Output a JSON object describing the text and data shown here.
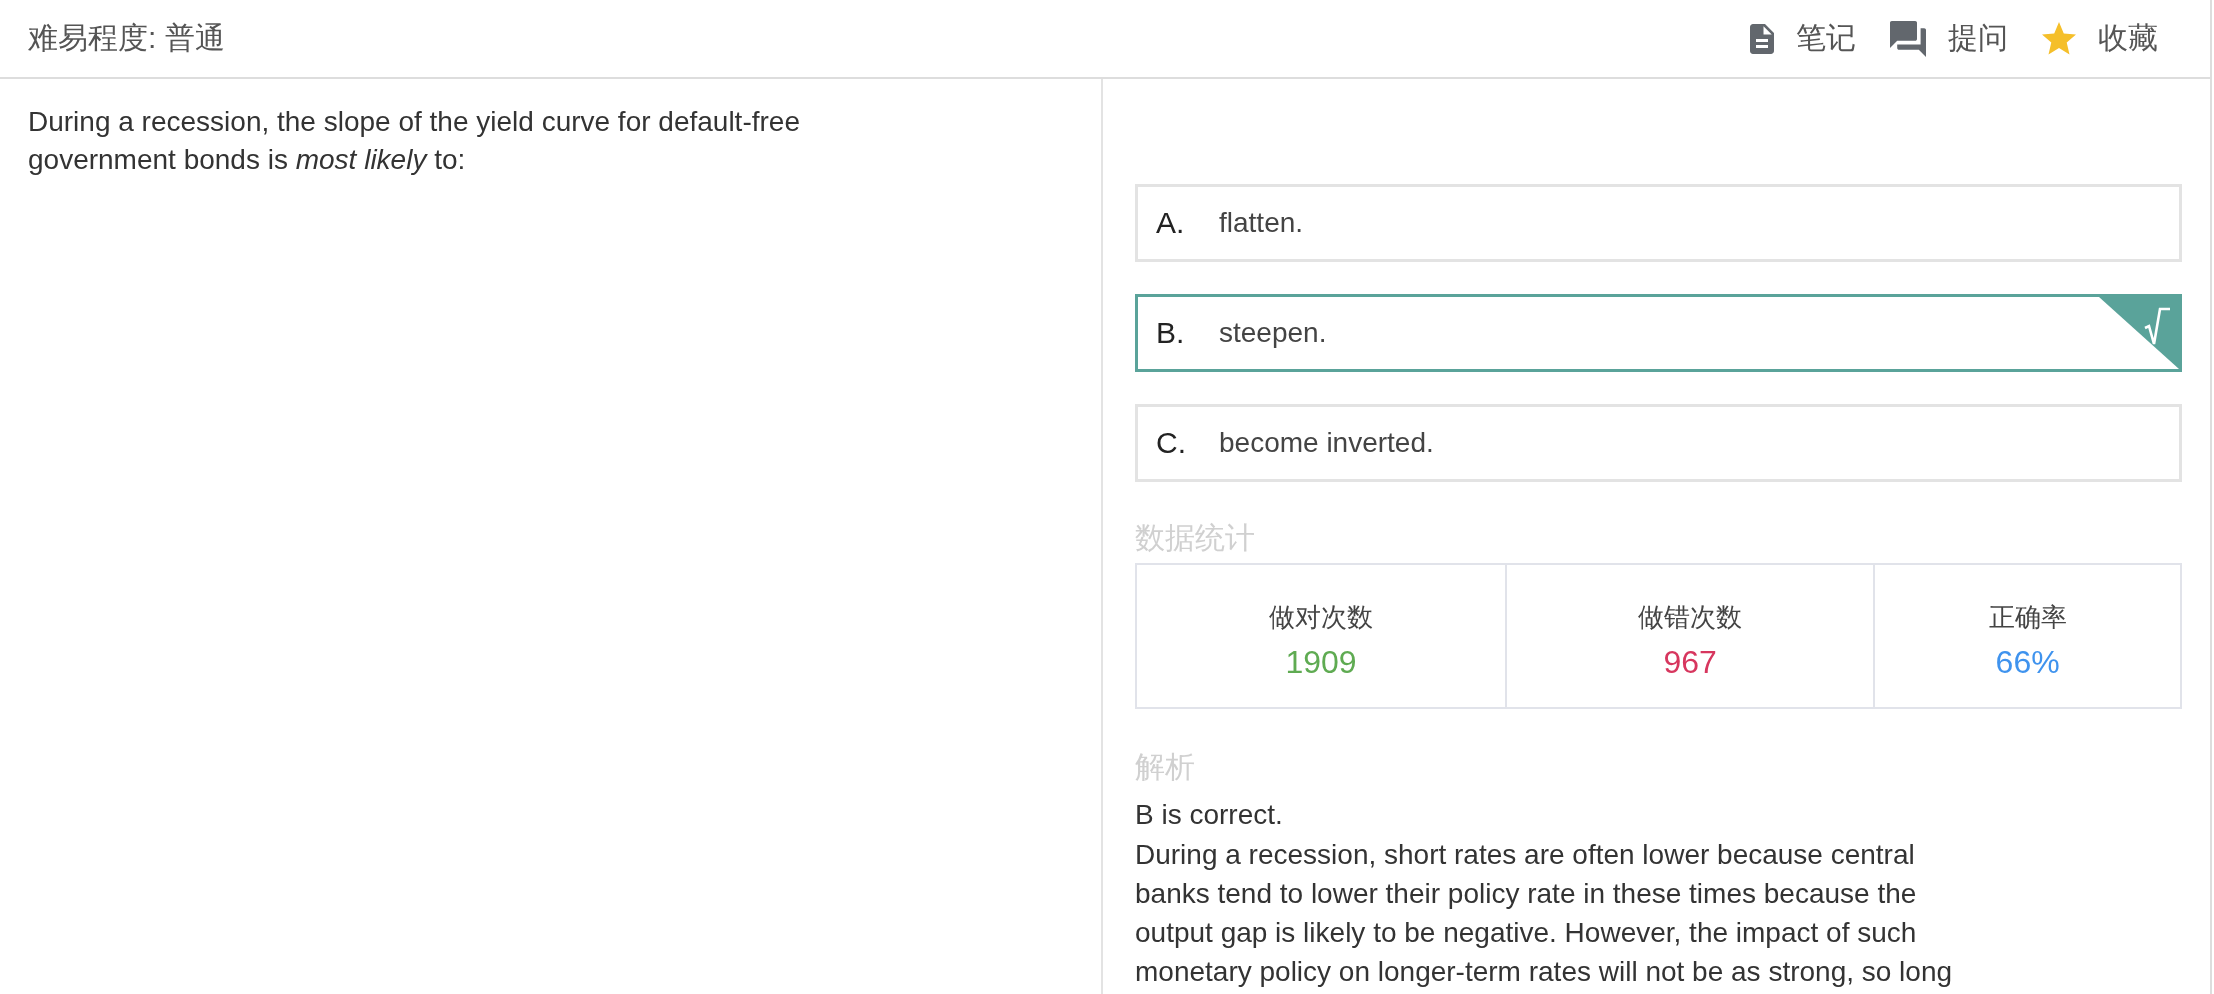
{
  "header": {
    "difficulty": "难易程度: 普通",
    "actions": [
      {
        "kind": "note",
        "label": "笔记"
      },
      {
        "kind": "ask",
        "label": "提问"
      },
      {
        "kind": "favorite",
        "label": "收藏"
      }
    ]
  },
  "question": {
    "text": "During a recession, the slope of the yield curve for default-free government bonds is *most likely* to:"
  },
  "options": [
    {
      "letter": "A.",
      "text": "flatten.",
      "selected": false
    },
    {
      "letter": "B.",
      "text": "steepen.",
      "selected": true
    },
    {
      "letter": "C.",
      "text": "become inverted.",
      "selected": false
    }
  ],
  "stats": {
    "title": "数据统计",
    "items": [
      {
        "label": "做对次数",
        "value": "1909",
        "color": "#5fab52"
      },
      {
        "label": "做错次数",
        "value": "967",
        "color": "#d7365e"
      },
      {
        "label": "正确率",
        "value": "66%",
        "color": "#3f93ee"
      }
    ]
  },
  "analysis": {
    "title": "解析",
    "verdict": "B is correct.",
    "text": "During a recession, short rates are often lower because central\nbanks tend to lower their policy rate in these times because the\noutput gap is likely to be negative. However, the impact of such\nmonetary policy on longer-term rates will not be as strong, so long"
  }
}
